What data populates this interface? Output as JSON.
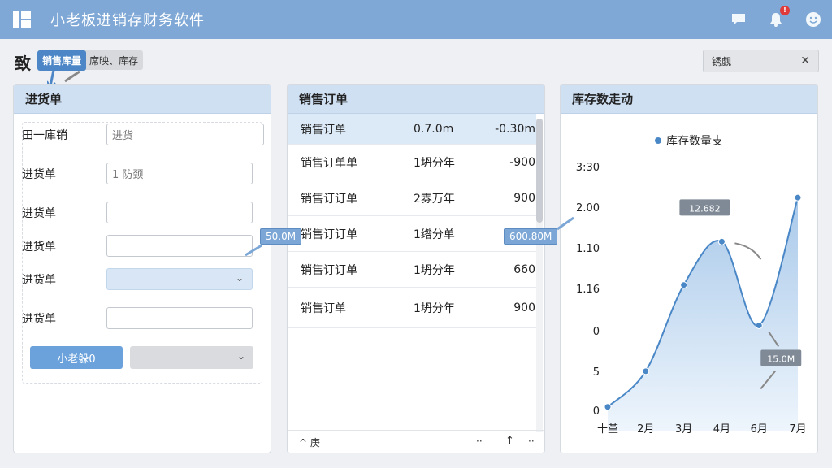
{
  "app": {
    "title": "小老板进销存财务软件"
  },
  "titlebar": {
    "icons": [
      "app-logo-icon",
      "chat-icon",
      "bell-icon",
      "smile-icon"
    ],
    "notification_badge": "!"
  },
  "toolbar": {
    "glyph": "致",
    "breadcrumb": {
      "active": "销售库量",
      "rest": "席映、库存"
    },
    "search": {
      "value": "锈觑"
    }
  },
  "left_panel": {
    "title": "进货单",
    "fields": [
      {
        "label": "田一庫销",
        "value": "进货"
      },
      {
        "label": "进货单",
        "value": "1 防颈"
      },
      {
        "label": "进货单",
        "value": ""
      },
      {
        "label": "进货单",
        "value": ""
      },
      {
        "label": "进货单",
        "value": ""
      },
      {
        "label": "进货单",
        "value": ""
      }
    ],
    "primary_button": "小老躲0"
  },
  "middle_panel": {
    "title": "销售订单",
    "rows": [
      {
        "name": "销售订单",
        "qty": "0.7.0m",
        "amount": "-0.30m"
      },
      {
        "name": "销售订单单",
        "qty": "1坍分年",
        "amount": "-900"
      },
      {
        "name": "销售订订单",
        "qty": "2雰万年",
        "amount": "900"
      },
      {
        "name": "销售订订单",
        "qty": "1绺分单",
        "amount": ""
      },
      {
        "name": "销售订订单",
        "qty": "1坍分年",
        "amount": "660"
      },
      {
        "name": "销售订单",
        "qty": "1坍分年",
        "amount": "900"
      }
    ],
    "pager": {
      "prev": "^ 庚",
      "a": "··",
      "b": "↑",
      "c": "··"
    }
  },
  "callouts": {
    "left": "50.0M",
    "middle": "600.80M"
  },
  "right_panel": {
    "title": "库存数走动"
  },
  "chart_data": {
    "type": "area",
    "legend": "库存数量支",
    "legend_position": "top",
    "categories": [
      "十堇",
      "2月",
      "3月",
      "4月",
      "6月",
      "7月"
    ],
    "x": [
      0,
      1,
      2,
      3,
      3.98,
      5
    ],
    "values": [
      -0.1,
      0.5,
      1.95,
      2.68,
      1.27,
      3.42
    ],
    "ytick_labels": [
      "3:30",
      "2.00",
      "1.10",
      "1.16",
      "0",
      "5",
      "0"
    ],
    "annotations": [
      "12.682",
      "15.0M"
    ],
    "colors": {
      "line": "#4a87c6",
      "fill_top": "#a9c9ea",
      "fill_bottom": "#eef5fc",
      "point": "#4a87c6"
    }
  }
}
